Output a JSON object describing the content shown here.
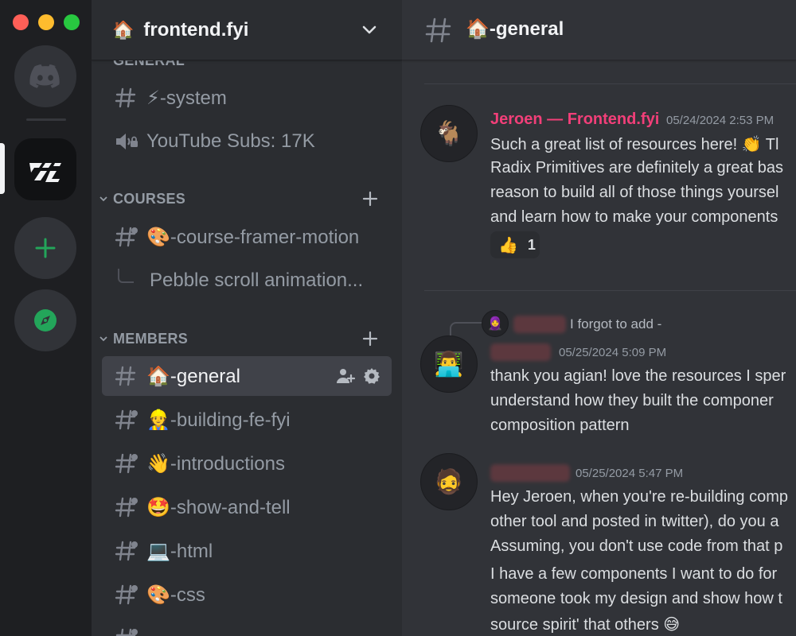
{
  "window": {
    "controls": [
      "close",
      "minimize",
      "zoom"
    ]
  },
  "servers": [
    {
      "name": "discord-home",
      "icon": "discord-logo-icon"
    },
    {
      "name": "frontend-fyi",
      "icon": "frontend-fyi-logo-icon",
      "active": true
    },
    {
      "name": "add-server",
      "icon": "plus-icon"
    },
    {
      "name": "explore",
      "icon": "compass-icon"
    }
  ],
  "guild": {
    "icon": "🏠",
    "name": "frontend.fyi"
  },
  "sidebar": {
    "top_category": "GENERAL",
    "channels_top": [
      {
        "type": "text",
        "label": "⚡-system"
      },
      {
        "type": "voice",
        "label": "YouTube Subs: 17K"
      }
    ],
    "courses": {
      "label": "COURSES",
      "channels": [
        {
          "type": "forum",
          "label": "🎨-course-framer-motion"
        },
        {
          "type": "thread",
          "label": "Pebble scroll animation..."
        }
      ]
    },
    "members": {
      "label": "MEMBERS",
      "channels": [
        {
          "type": "text",
          "label": "🏠-general",
          "active": true
        },
        {
          "type": "forum",
          "label": "👷-building-fe-fyi"
        },
        {
          "type": "forum",
          "label": "👋-introductions"
        },
        {
          "type": "forum",
          "label": "🤩-show-and-tell"
        },
        {
          "type": "forum",
          "label": "💻-html"
        },
        {
          "type": "forum",
          "label": "🎨-css"
        }
      ]
    }
  },
  "chat": {
    "channel_title": "🏠-general",
    "messages": [
      {
        "author": "Jeroen — Frontend.fyi",
        "author_color": "#f23f79",
        "timestamp": "05/24/2024 2:53 PM",
        "avatar": "🐐",
        "lines": [
          "Such a great list of resources here! 👏 Tl",
          "Radix Primitives are definitely a great bas",
          "reason to build all of those things yoursel",
          "and learn how to make your components"
        ],
        "reaction": {
          "emoji": "👍",
          "count": "1"
        }
      },
      {
        "reply_to": {
          "avatar": "🧕",
          "text": "I forgot to add -"
        },
        "timestamp": "05/25/2024 5:09 PM",
        "avatar": "👨‍💻",
        "lines": [
          "thank you agian! love the resources I sper",
          "understand how they built the componer",
          "composition pattern"
        ]
      },
      {
        "timestamp": "05/25/2024 5:47 PM",
        "avatar": "🧔",
        "lines": [
          "Hey Jeroen, when you're re-building comp",
          "other tool and posted in twitter), do you a",
          "Assuming, you don't use code from that p"
        ],
        "lines2": [
          "I have a few components I want to do for",
          "someone took my design and show how t",
          "source spirit' that others 😅"
        ]
      }
    ]
  }
}
